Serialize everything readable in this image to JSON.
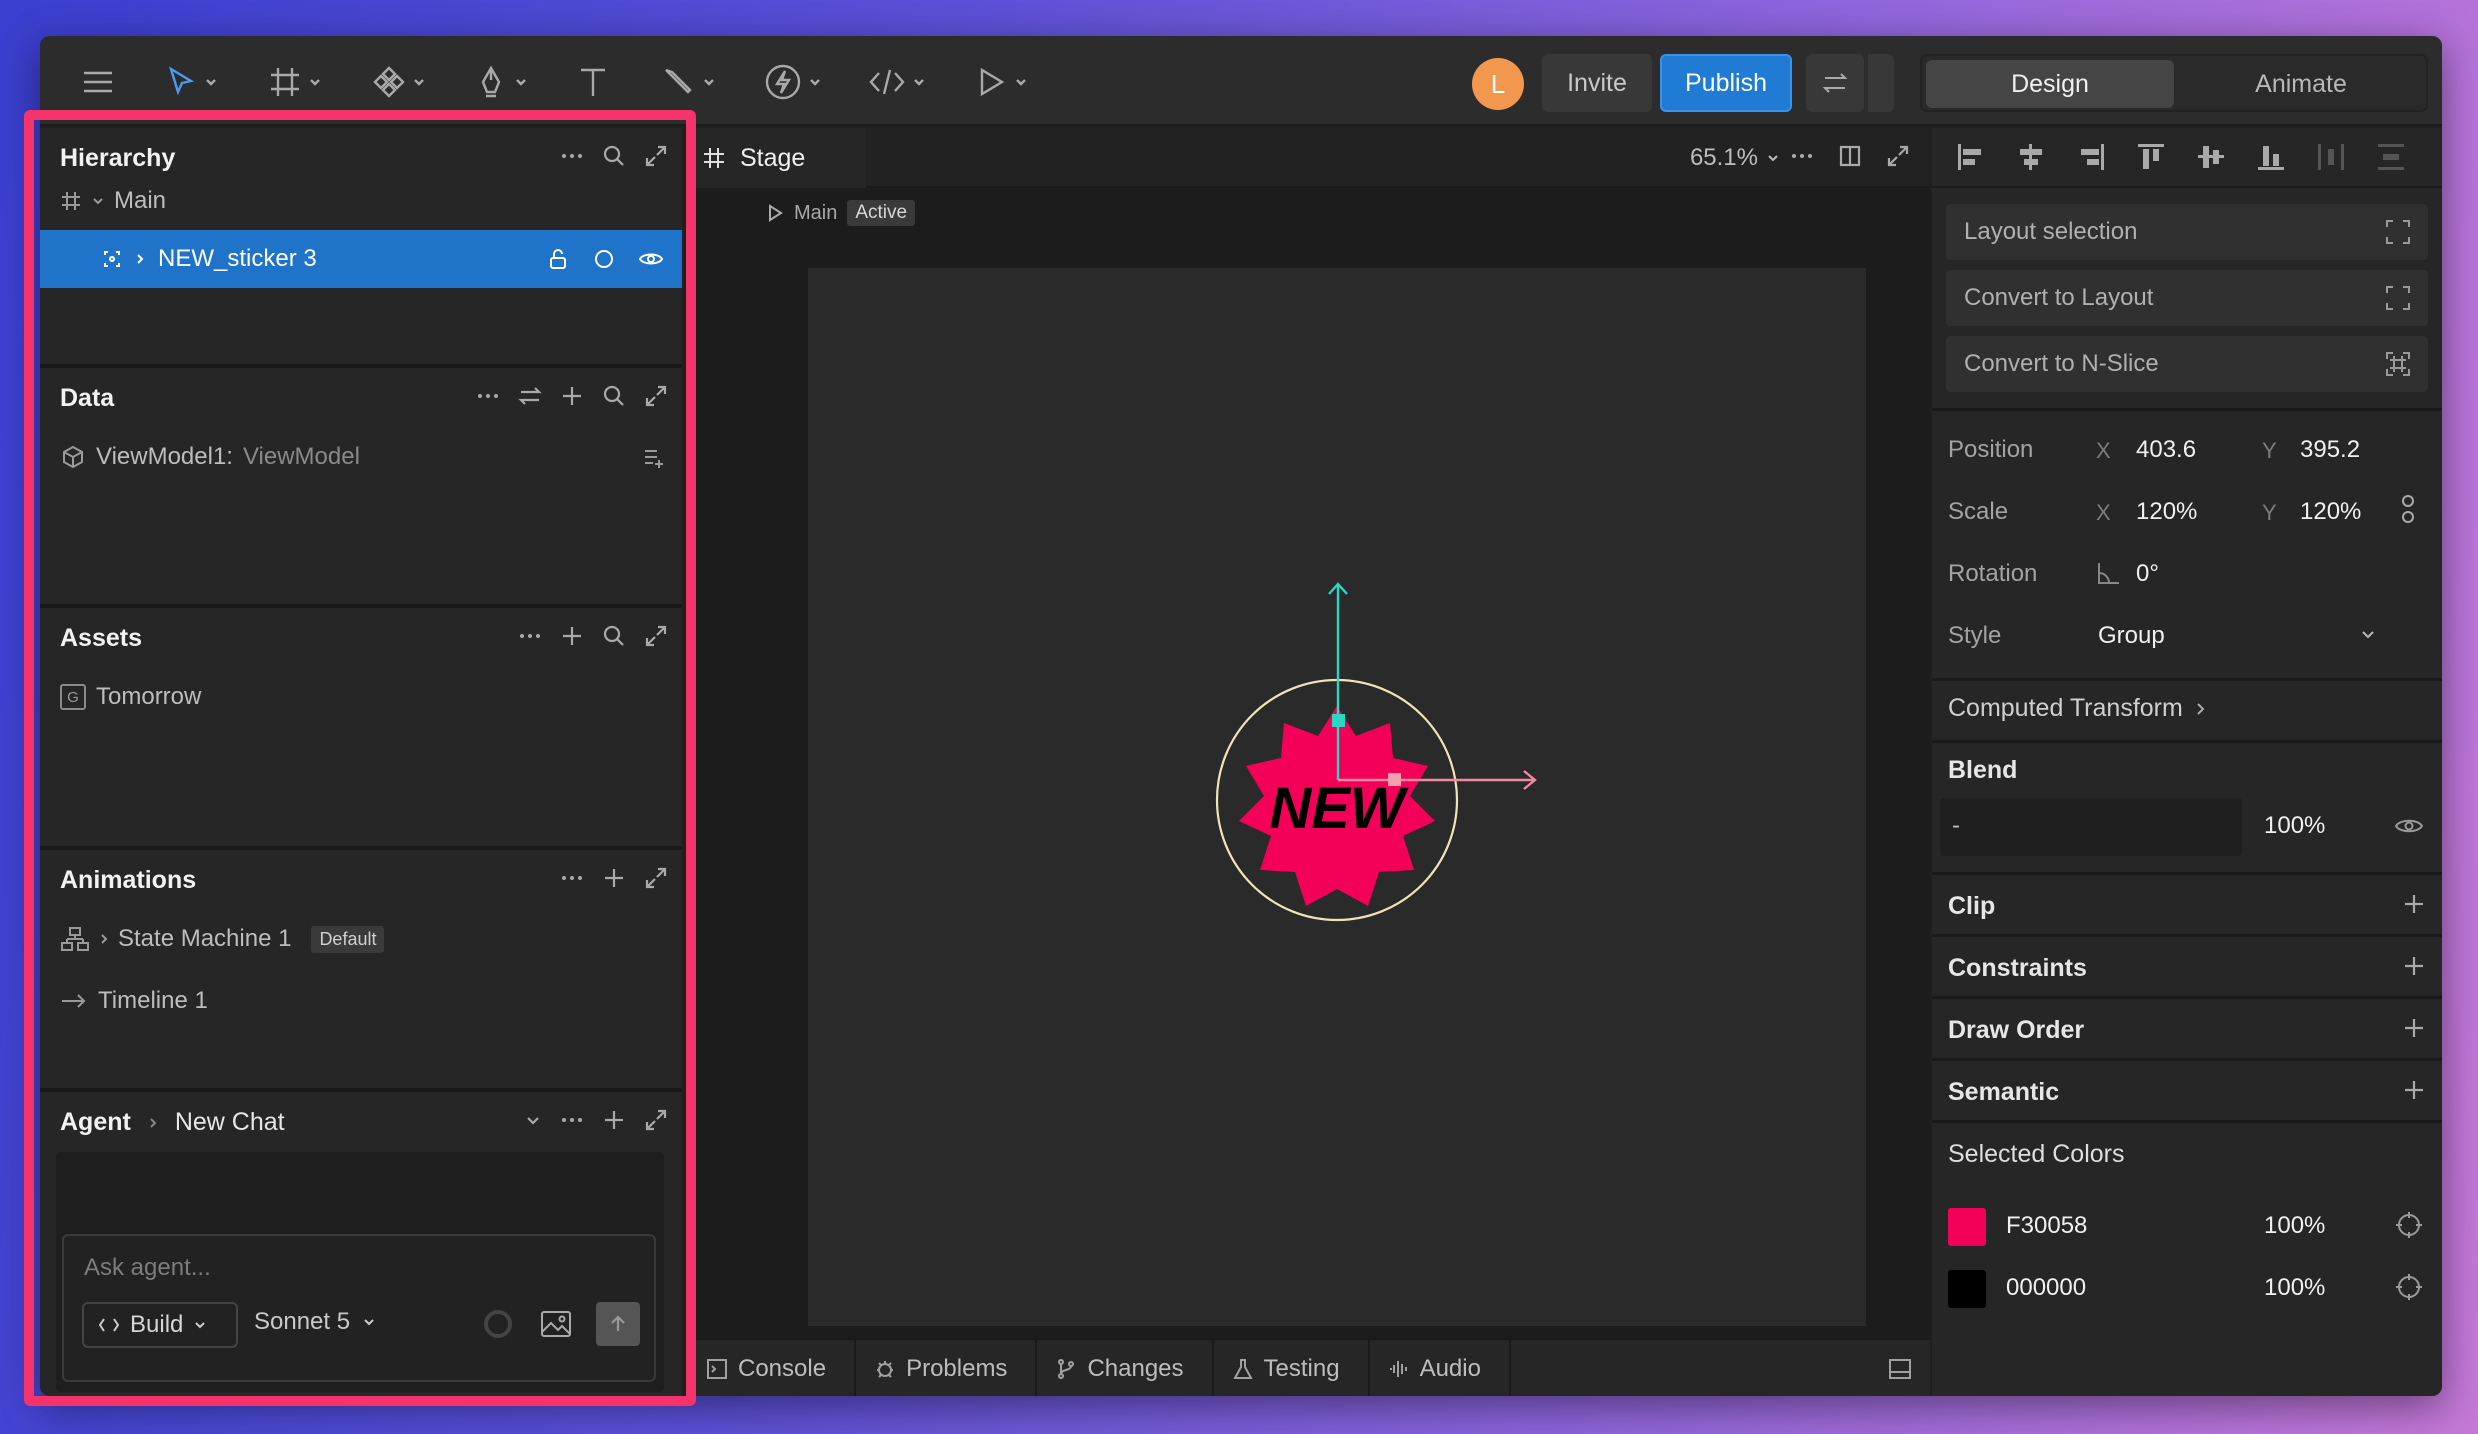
{
  "toolbar": {
    "avatar_initial": "L",
    "invite_label": "Invite",
    "publish_label": "Publish",
    "mode_design": "Design",
    "mode_animate": "Animate"
  },
  "hierarchy": {
    "title": "Hierarchy",
    "root": "Main",
    "selected_item": "NEW_sticker 3"
  },
  "data_panel": {
    "title": "Data",
    "viewmodel_name": "ViewModel1:",
    "viewmodel_type": "ViewModel"
  },
  "assets": {
    "title": "Assets",
    "badge": "G",
    "item": "Tomorrow"
  },
  "animations": {
    "title": "Animations",
    "state_machine": "State Machine 1",
    "default_badge": "Default",
    "timeline": "Timeline 1"
  },
  "agent": {
    "title": "Agent",
    "chat_name": "New Chat",
    "ask_placeholder": "Ask agent...",
    "build_label": "Build",
    "model": "Sonnet 5"
  },
  "stage": {
    "tab": "Stage",
    "zoom": "65.1%",
    "artboard_name": "Main",
    "artboard_state": "Active",
    "sticker_text": "NEW"
  },
  "bottom_tabs": [
    "Console",
    "Problems",
    "Changes",
    "Testing",
    "Audio"
  ],
  "right_panel": {
    "layout_selection": "Layout selection",
    "convert_layout": "Convert to Layout",
    "convert_nslice": "Convert to N-Slice",
    "position_label": "Position",
    "scale_label": "Scale",
    "rotation_label": "Rotation",
    "style_label": "Style",
    "axis_x": "X",
    "axis_y": "Y",
    "position_x": "403.6",
    "position_y": "395.2",
    "scale_x": "120%",
    "scale_y": "120%",
    "rotation": "0°",
    "style": "Group",
    "computed_transform": "Computed Transform",
    "blend_title": "Blend",
    "blend_mode": "-",
    "blend_opacity": "100%",
    "clip": "Clip",
    "constraints": "Constraints",
    "draw_order": "Draw Order",
    "semantic": "Semantic",
    "selected_colors_title": "Selected Colors",
    "colors": [
      {
        "hex": "F30058",
        "opacity": "100%"
      },
      {
        "hex": "000000",
        "opacity": "100%"
      }
    ]
  },
  "colors": {
    "accent": "#1f73c8",
    "sticker": "#f30058",
    "highlight": "#f5336a"
  }
}
